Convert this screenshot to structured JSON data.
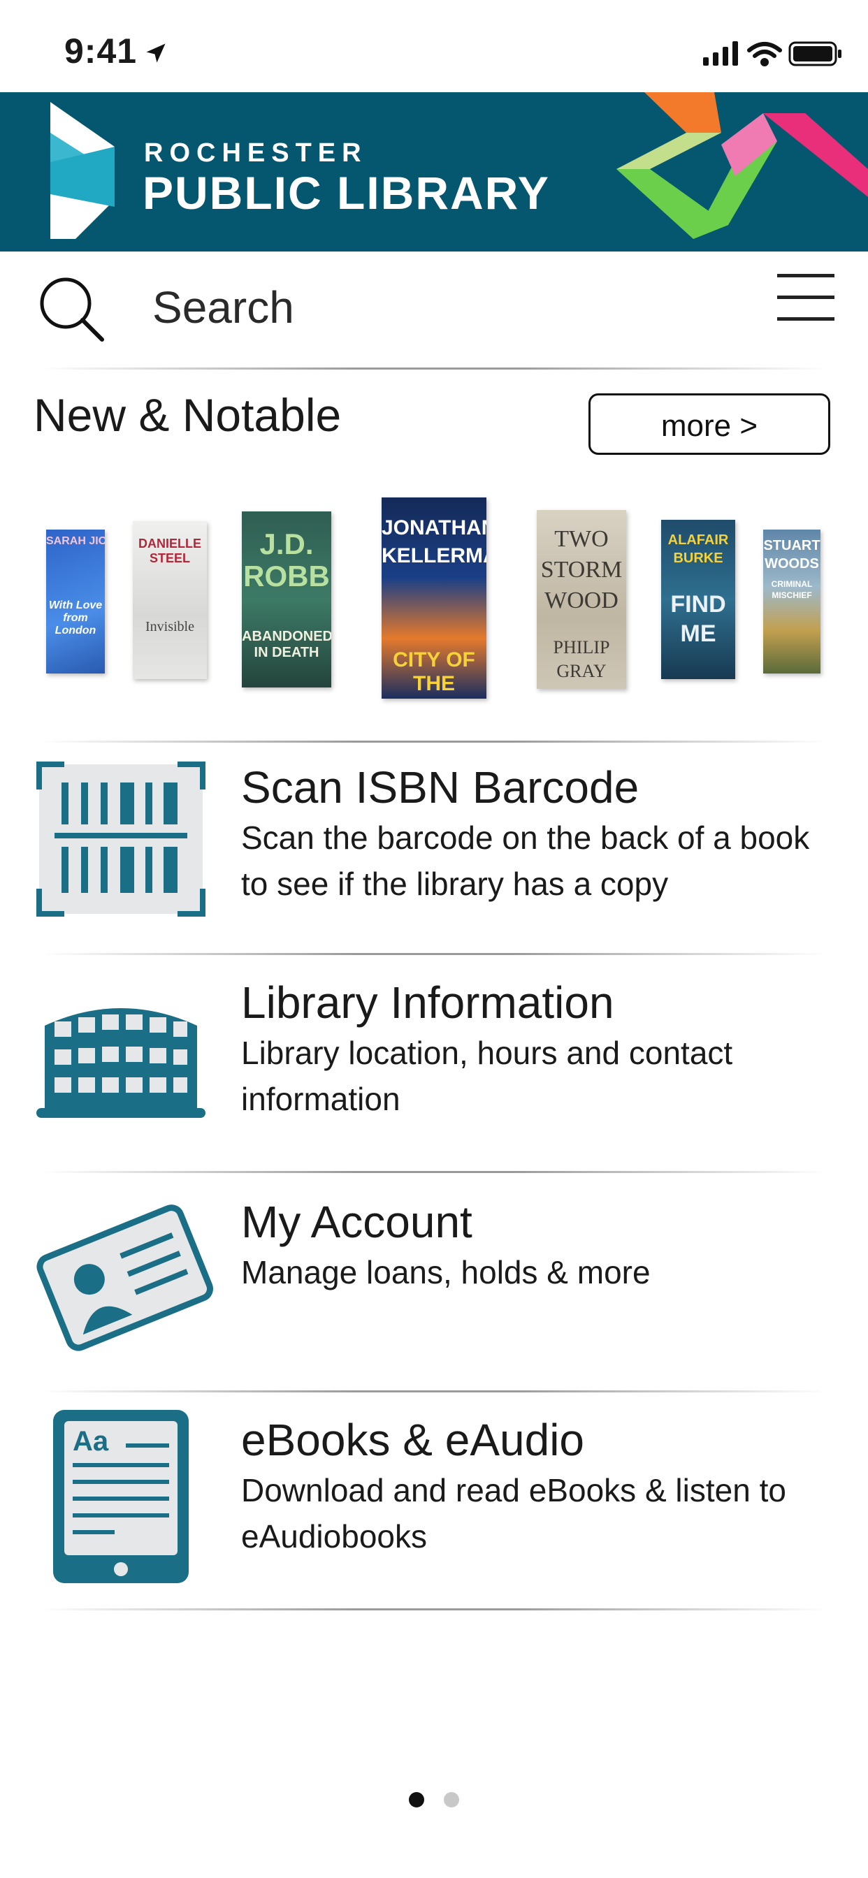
{
  "status_bar": {
    "time": "9:41"
  },
  "banner": {
    "org_line1": "ROCHESTER",
    "org_line2": "PUBLIC LIBRARY",
    "brand_color": "#05566f"
  },
  "search": {
    "placeholder": "Search"
  },
  "new_notable": {
    "title": "New & Notable",
    "more_label": "more >",
    "covers": [
      {
        "line1": "SARAH JIO",
        "line2": "With Love from London"
      },
      {
        "line1": "DANIELLE STEEL",
        "line2": "Invisible"
      },
      {
        "line1": "J.D. ROBB",
        "line2": "ABANDONED IN DEATH"
      },
      {
        "line1": "JONATHAN KELLERMAN",
        "line2": "CITY OF THE DEAD"
      },
      {
        "line1": "TWO STORM WOOD",
        "line2": "PHILIP GRAY"
      },
      {
        "line1": "ALAFAIR BURKE",
        "line2": "FIND ME"
      },
      {
        "line1": "STUART WOODS",
        "line2": "CRIMINAL MISCHIEF"
      }
    ]
  },
  "features": [
    {
      "title": "Scan ISBN Barcode",
      "description": "Scan the barcode on the back of a book to see if the library has a copy",
      "icon": "barcode-scan-icon"
    },
    {
      "title": "Library Information",
      "description": "Library location, hours and contact information",
      "icon": "library-building-icon"
    },
    {
      "title": "My Account",
      "description": "Manage loans, holds & more",
      "icon": "library-card-icon"
    },
    {
      "title": "eBooks & eAudio",
      "description": "Download and read eBooks & listen to eAudiobooks",
      "icon": "ereader-icon"
    }
  ],
  "icon_ereader_text": "Aa",
  "pagination": {
    "total": 2,
    "current": 1
  },
  "colors": {
    "accent": "#1a6f86",
    "icon_fill": "#e6e7e8"
  }
}
